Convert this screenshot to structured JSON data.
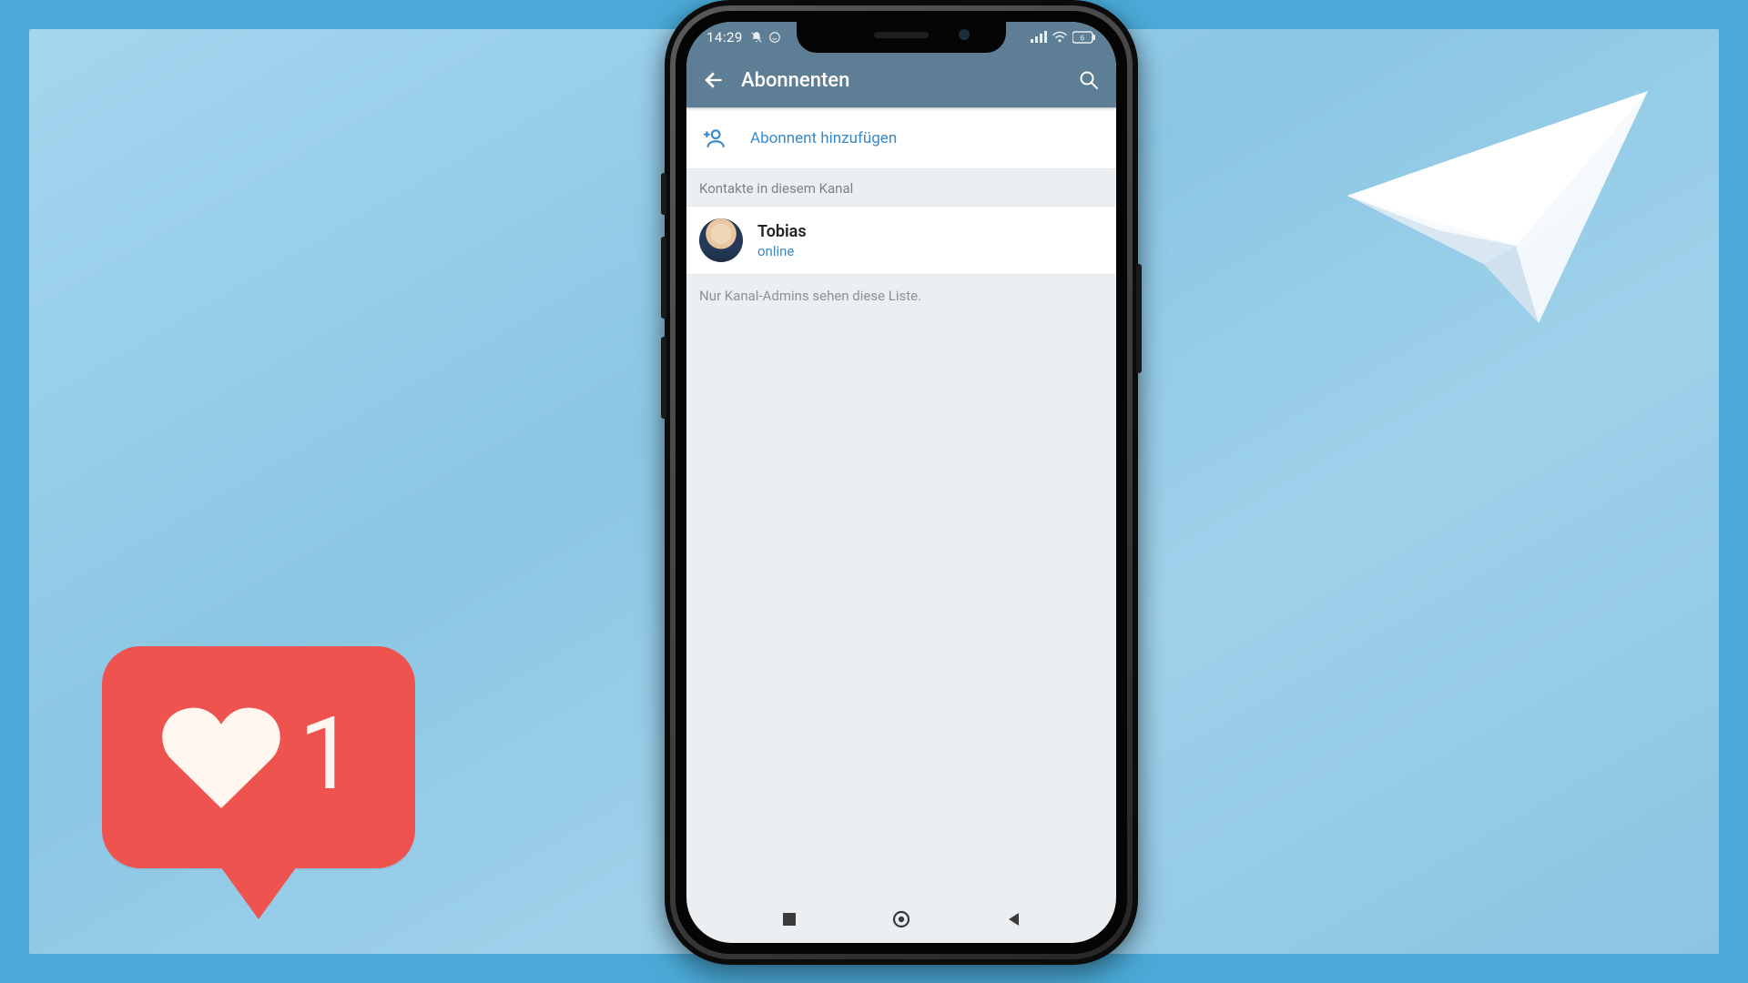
{
  "statusbar": {
    "time": "14:29"
  },
  "header": {
    "title": "Abonnenten"
  },
  "add_subscriber": {
    "label": "Abonnent hinzufügen"
  },
  "section": {
    "contacts_label": "Kontakte in diesem Kanal"
  },
  "contacts": [
    {
      "name": "Tobias",
      "status": "online"
    }
  ],
  "footnote": "Nur Kanal-Admins sehen diese Liste.",
  "like": {
    "count": "1"
  }
}
